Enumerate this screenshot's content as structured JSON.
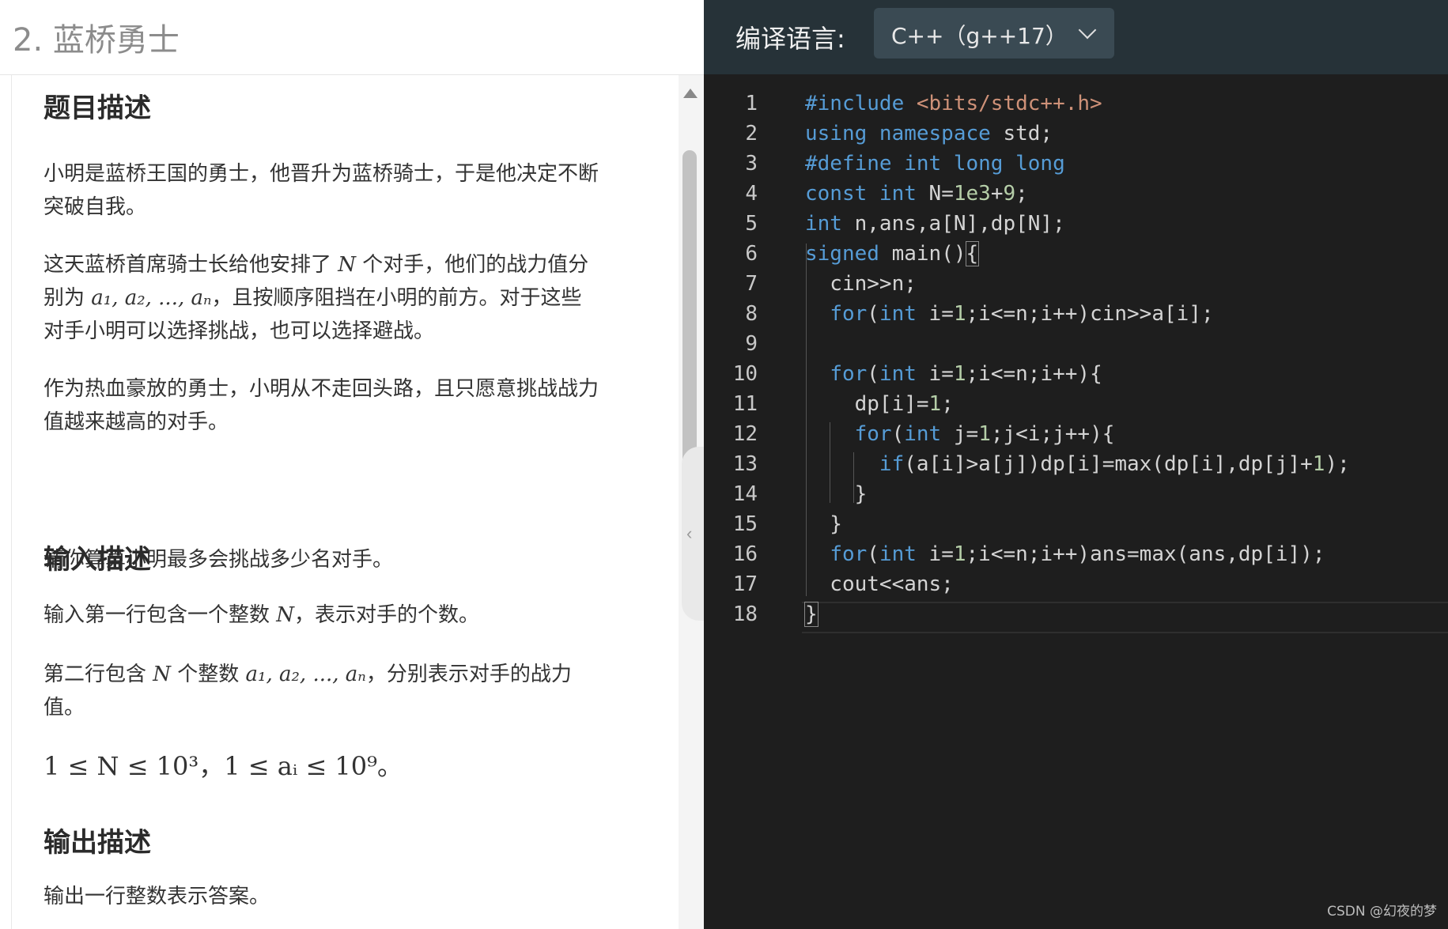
{
  "problem": {
    "title": "2. 蓝桥勇士",
    "sections": {
      "desc_heading": "题目描述",
      "desc_p1_l1": "小明是蓝桥王国的勇士，他晋升为蓝桥骑士，于是他决定不断",
      "desc_p1_l2": "突破自我。",
      "desc_p2_l1a": "这天蓝桥首席骑士长给他安排了 ",
      "desc_p2_l1b": " 个对手，他们的战力值分",
      "desc_p2_l2a": "别为 ",
      "desc_p2_l2b": "，且按顺序阻挡在小明的前方。对于这些",
      "desc_p2_l3": "对手小明可以选择挑战，也可以选择避战。",
      "desc_p3_l1": "作为热血豪放的勇士，小明从不走回头路，且只愿意挑战战力",
      "desc_p3_l2": "值越来越高的对手。",
      "desc_p4": "请你算算小明最多会挑战多少名对手。",
      "input_heading": "输入描述",
      "input_p1a": "输入第一行包含一个整数 ",
      "input_p1b": "，表示对手的个数。",
      "input_p2a": "第二行包含 ",
      "input_p2b": " 个整数 ",
      "input_p2c": "，分别表示对手的战力",
      "input_p2d": "值。",
      "constraint_sep": "，",
      "constraint_end": "。",
      "output_heading": "输出描述",
      "output_p1": "输出一行整数表示答案。"
    },
    "math": {
      "N": "N",
      "seq": "a₁, a₂, ..., aₙ",
      "c1": "1 ≤ N ≤ 10³",
      "c2": "1 ≤ aᵢ ≤ 10⁹"
    }
  },
  "editor": {
    "lang_label": "编译语言:",
    "lang_value": "C++（g++17）",
    "line_numbers": [
      "1",
      "2",
      "3",
      "4",
      "5",
      "6",
      "7",
      "8",
      "9",
      "10",
      "11",
      "12",
      "13",
      "14",
      "15",
      "16",
      "17",
      "18"
    ]
  },
  "watermark": "CSDN @幻夜的梦"
}
